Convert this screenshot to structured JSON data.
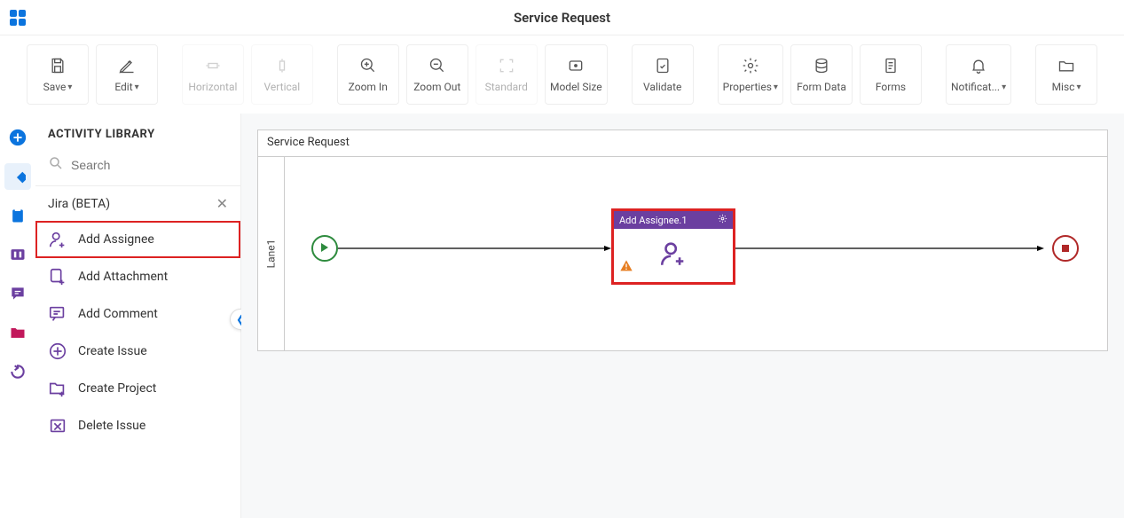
{
  "header": {
    "title": "Service Request"
  },
  "toolbar": {
    "save": "Save",
    "edit": "Edit",
    "horizontal": "Horizontal",
    "vertical": "Vertical",
    "zoom_in": "Zoom In",
    "zoom_out": "Zoom Out",
    "standard": "Standard",
    "model_size": "Model Size",
    "validate": "Validate",
    "properties": "Properties",
    "form_data": "Form Data",
    "forms": "Forms",
    "notifications": "Notificat...",
    "misc": "Misc"
  },
  "sidebar": {
    "title": "ACTIVITY LIBRARY",
    "search_placeholder": "Search",
    "group": "Jira (BETA)",
    "items": [
      {
        "label": "Add Assignee"
      },
      {
        "label": "Add Attachment"
      },
      {
        "label": "Add Comment"
      },
      {
        "label": "Create Issue"
      },
      {
        "label": "Create Project"
      },
      {
        "label": "Delete Issue"
      }
    ]
  },
  "canvas": {
    "process_title": "Service Request",
    "lane_label": "Lane1",
    "activity": {
      "title": "Add Assignee.1"
    }
  },
  "colors": {
    "accent": "#0b74de",
    "purple": "#6b3fa0",
    "highlight": "#d22",
    "green": "#2e8b3e",
    "red": "#b02828"
  }
}
